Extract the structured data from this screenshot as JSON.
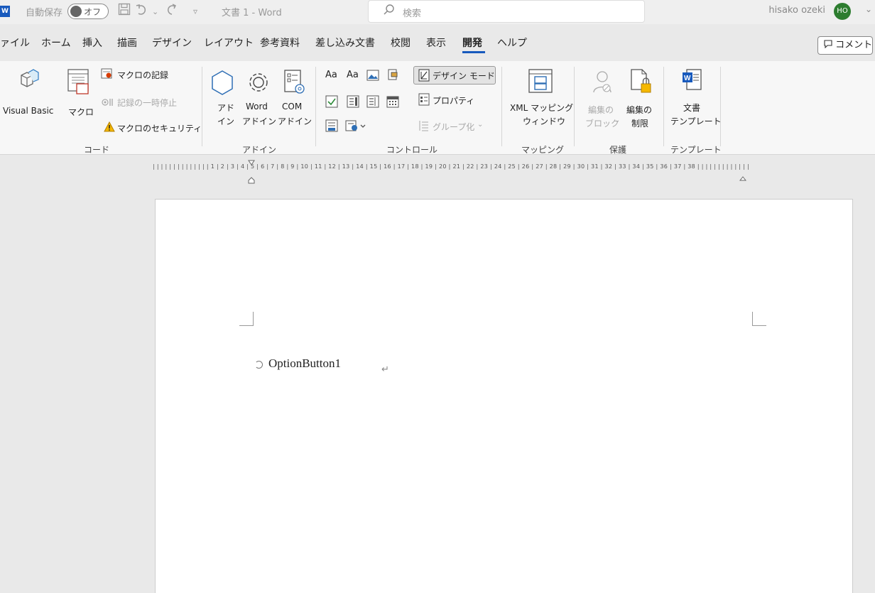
{
  "titlebar": {
    "logo": "W",
    "autosave_label": "自動保存",
    "autosave_state": "オフ",
    "doc_title": "文書 1  -  Word",
    "search_placeholder": "検索",
    "user_name": "hisako ozeki",
    "user_initials": "HO"
  },
  "tabs": [
    "ァイル",
    "ホーム",
    "挿入",
    "描画",
    "デザイン",
    "レイアウト",
    "参考資料",
    "差し込み文書",
    "校閲",
    "表示",
    "開発",
    "ヘルプ"
  ],
  "active_tab": "開発",
  "comment_label": "コメント",
  "ribbon": {
    "code": {
      "visual_basic": "Visual Basic",
      "macro": "マクロ",
      "record_macro": "マクロの記録",
      "pause_recording": "記録の一時停止",
      "macro_security": "マクロのセキュリティ",
      "group": "コード"
    },
    "addins": {
      "addin_line1": "アド",
      "addin_line2": "イン",
      "word_addin_line1": "Word",
      "word_addin_line2": "アドイン",
      "com_addin_line1": "COM",
      "com_addin_line2": "アドイン",
      "group": "アドイン"
    },
    "controls": {
      "design_mode": "デザイン モード",
      "properties": "プロパティ",
      "group_btn": "グループ化",
      "group": "コントロール"
    },
    "mapping": {
      "xml_line1": "XML マッピング",
      "xml_line2": "ウィンドウ",
      "group": "マッピング"
    },
    "protect": {
      "block_line1": "編集の",
      "block_line2": "ブロック",
      "restrict_line1": "編集の",
      "restrict_line2": "制限",
      "group": "保護"
    },
    "templates": {
      "doc_line1": "文書",
      "doc_line2": "テンプレート",
      "group": "テンプレート"
    }
  },
  "ruler": {
    "text": "| | | | | | | | | | | | |   | 1 | 2 | 3 | 4 | 5 | 6 | 7 | 8 | 9 | 10 | 11 | 12 | 13 | 14 | 15 | 16 | 17 | 18 | 19 | 20 | 21 | 22 | 23 | 24 | 25 | 26 | 27 | 28 | 29 | 30 | 31 | 32 | 33 | 34 | 35 | 36 | 37 | 38 |   | | | | | | | | | | | |"
  },
  "document": {
    "option_button_label": "OptionButton1",
    "paragraph_mark": "↵"
  },
  "colors": {
    "word_blue": "#185abd",
    "avatar_green": "#2d7d2f"
  }
}
